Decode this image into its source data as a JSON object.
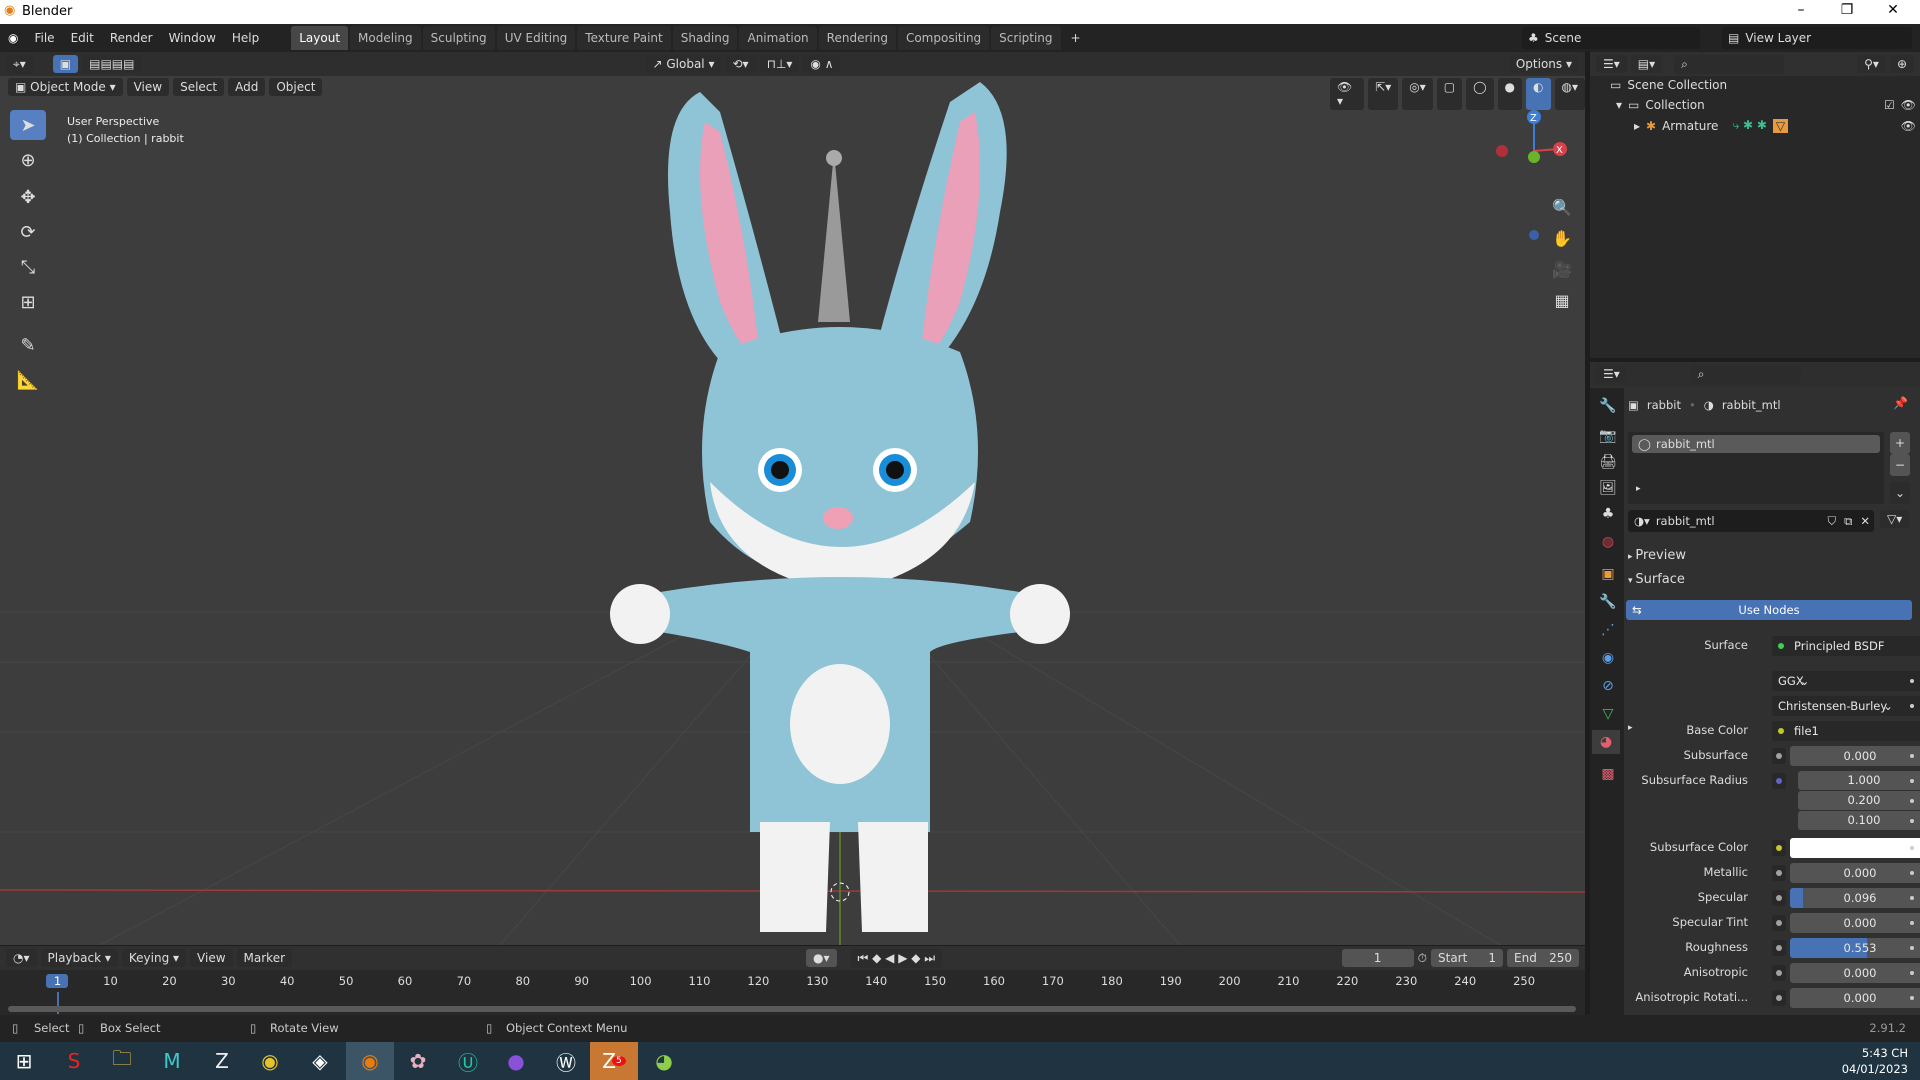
{
  "window": {
    "title": "Blender"
  },
  "menu": [
    "File",
    "Edit",
    "Render",
    "Window",
    "Help"
  ],
  "workspaces": [
    "Layout",
    "Modeling",
    "Sculpting",
    "UV Editing",
    "Texture Paint",
    "Shading",
    "Animation",
    "Rendering",
    "Compositing",
    "Scripting"
  ],
  "active_workspace": "Layout",
  "scene": {
    "name": "Scene",
    "view_layer": "View Layer"
  },
  "viewport": {
    "transform": "Global",
    "options": "Options",
    "mode": "Object Mode",
    "menus": [
      "View",
      "Select",
      "Add",
      "Object"
    ],
    "overlay_line1": "User Perspective",
    "overlay_line2": "(1) Collection | rabbit",
    "gizmo": {
      "z": "Z",
      "x": "X"
    }
  },
  "outliner": {
    "items": [
      {
        "label": "Scene Collection"
      },
      {
        "label": "Collection"
      },
      {
        "label": "Armature"
      }
    ]
  },
  "properties": {
    "object": "rabbit",
    "material": "rabbit_mtl",
    "slot": "rabbit_mtl",
    "datablock": "rabbit_mtl",
    "panels": {
      "preview": "Preview",
      "surface": "Surface"
    },
    "use_nodes": "Use Nodes",
    "surface_label": "Surface",
    "surface_value": "Principled BSDF",
    "distribution": "GGX",
    "subsurface_method": "Christensen-Burley",
    "fields": [
      {
        "label": "Base Color",
        "value": "file1",
        "socket": "#c7c729"
      },
      {
        "label": "Subsurface",
        "value": "0.000",
        "fill": 0
      },
      {
        "label": "Subsurface Radius",
        "values": [
          "1.000",
          "0.200",
          "0.100"
        ],
        "socket": "#6363c7"
      },
      {
        "label": "Subsurface Color",
        "color": "#ffffff",
        "socket": "#c7c729"
      },
      {
        "label": "Metallic",
        "value": "0.000",
        "fill": 0
      },
      {
        "label": "Specular",
        "value": "0.096",
        "fill": 0.096
      },
      {
        "label": "Specular Tint",
        "value": "0.000",
        "fill": 0
      },
      {
        "label": "Roughness",
        "value": "0.553",
        "fill": 0.553
      },
      {
        "label": "Anisotropic",
        "value": "0.000",
        "fill": 0
      },
      {
        "label": "Anisotropic Rotati...",
        "value": "0.000",
        "fill": 0
      }
    ]
  },
  "timeline": {
    "menus": [
      "Playback",
      "Keying",
      "View",
      "Marker"
    ],
    "current_frame": "1",
    "start_label": "Start",
    "start": "1",
    "end_label": "End",
    "end": "250",
    "ticks": [
      "1",
      "10",
      "20",
      "30",
      "40",
      "50",
      "60",
      "70",
      "80",
      "90",
      "100",
      "110",
      "120",
      "130",
      "140",
      "150",
      "160",
      "170",
      "180",
      "190",
      "200",
      "210",
      "220",
      "230",
      "240",
      "250"
    ]
  },
  "status": {
    "select": "Select",
    "box_select": "Box Select",
    "rotate": "Rotate View",
    "context": "Object Context Menu",
    "version": "2.91.2"
  },
  "taskbar": {
    "time": "5:43 CH",
    "date": "04/01/2023",
    "badge": "5"
  },
  "colors": {
    "accent": "#4772b3",
    "viewport_bg": "#3d3d3d",
    "rabbit_body": "#8fc4d6"
  }
}
